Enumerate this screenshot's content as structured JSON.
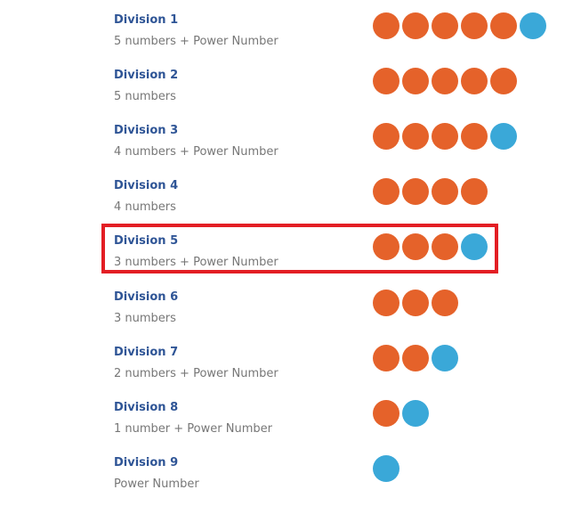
{
  "colors": {
    "number_ball": "#e5622a",
    "power_ball": "#3aa8d8",
    "title": "#2f5596",
    "description": "#777777",
    "highlight_border": "#e31e24"
  },
  "divisions": [
    {
      "name": "Division 1",
      "description": "5 numbers + Power Number",
      "numbers": 5,
      "power": 1
    },
    {
      "name": "Division 2",
      "description": "5 numbers",
      "numbers": 5,
      "power": 0
    },
    {
      "name": "Division 3",
      "description": "4 numbers + Power Number",
      "numbers": 4,
      "power": 1
    },
    {
      "name": "Division 4",
      "description": "4 numbers",
      "numbers": 4,
      "power": 0
    },
    {
      "name": "Division 5",
      "description": "3 numbers + Power Number",
      "numbers": 3,
      "power": 1,
      "highlighted": true
    },
    {
      "name": "Division 6",
      "description": "3 numbers",
      "numbers": 3,
      "power": 0
    },
    {
      "name": "Division 7",
      "description": "2 numbers + Power Number",
      "numbers": 2,
      "power": 1
    },
    {
      "name": "Division 8",
      "description": "1 number + Power Number",
      "numbers": 1,
      "power": 1
    },
    {
      "name": "Division 9",
      "description": "Power Number",
      "numbers": 0,
      "power": 1
    }
  ]
}
